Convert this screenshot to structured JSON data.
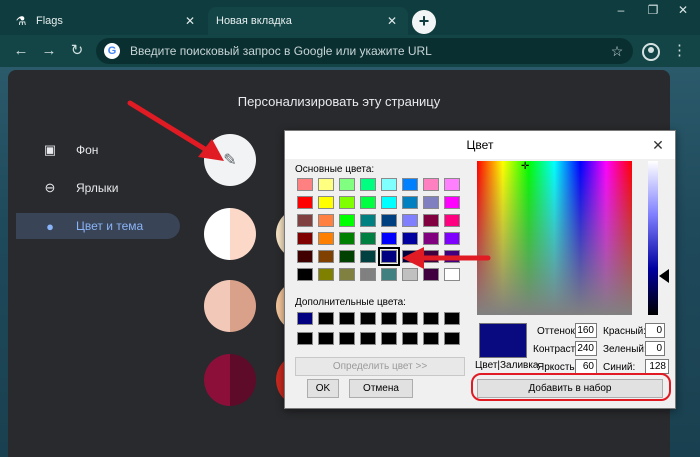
{
  "browser": {
    "tabs": [
      {
        "title": "Flags",
        "active": false
      },
      {
        "title": "Новая вкладка",
        "active": true
      }
    ],
    "omnibox_placeholder": "Введите поисковый запрос в Google или укажите URL"
  },
  "customize": {
    "title": "Персонализировать эту страницу",
    "sidebar": [
      {
        "label": "Фон",
        "icon": "image-icon",
        "selected": false
      },
      {
        "label": "Ярлыки",
        "icon": "link-icon",
        "selected": false
      },
      {
        "label": "Цвет и тема",
        "icon": "palette-icon",
        "selected": true
      }
    ]
  },
  "color_dialog": {
    "title": "Цвет",
    "basic_colors_label": "Основные цвета:",
    "custom_colors_label": "Дополнительные цвета:",
    "define_button": "Определить цвет >>",
    "ok_button": "OK",
    "cancel_button": "Отмена",
    "add_button": "Добавить в набор",
    "preview_label": "Цвет|Заливка",
    "fields": {
      "hue_label": "Оттенок:",
      "hue": "160",
      "sat_label": "Контраст:",
      "sat": "240",
      "lum_label": "Яркость:",
      "lum": "60",
      "red_label": "Красный:",
      "red": "0",
      "green_label": "Зеленый:",
      "green": "0",
      "blue_label": "Синий:",
      "blue": "128"
    },
    "selected_color": "#000080",
    "basic_colors": [
      "#ff8080",
      "#ffff80",
      "#80ff80",
      "#00ff80",
      "#80ffff",
      "#0080ff",
      "#ff80c0",
      "#ff80ff",
      "#ff0000",
      "#ffff00",
      "#80ff00",
      "#00ff40",
      "#00ffff",
      "#0080c0",
      "#8080c0",
      "#ff00ff",
      "#804040",
      "#ff8040",
      "#00ff00",
      "#008080",
      "#004080",
      "#8080ff",
      "#800040",
      "#ff0080",
      "#800000",
      "#ff8000",
      "#008000",
      "#008040",
      "#0000ff",
      "#0000a0",
      "#800080",
      "#8000ff",
      "#400000",
      "#804000",
      "#004000",
      "#004040",
      "#000080",
      "#000040",
      "#400040",
      "#400080",
      "#000000",
      "#808000",
      "#808040",
      "#808080",
      "#408080",
      "#c0c0c0",
      "#400040",
      "#ffffff"
    ],
    "custom_colors": [
      "#000080",
      "#000000",
      "#000000",
      "#000000",
      "#000000",
      "#000000",
      "#000000",
      "#000000",
      "#000000",
      "#000000",
      "#000000",
      "#000000",
      "#000000",
      "#000000",
      "#000000",
      "#000000"
    ]
  },
  "theme_swatches": [
    {
      "left": "#ffffff",
      "right": "#fbd8c8"
    },
    {
      "left": "#f2c9b9",
      "right": "#d9a08a"
    },
    {
      "left": "#8c0f3a",
      "right": "#5e0b29"
    }
  ],
  "colors": {
    "highlight": "#e01b24",
    "accent": "#8ab4f8",
    "panel": "#292a2d"
  }
}
